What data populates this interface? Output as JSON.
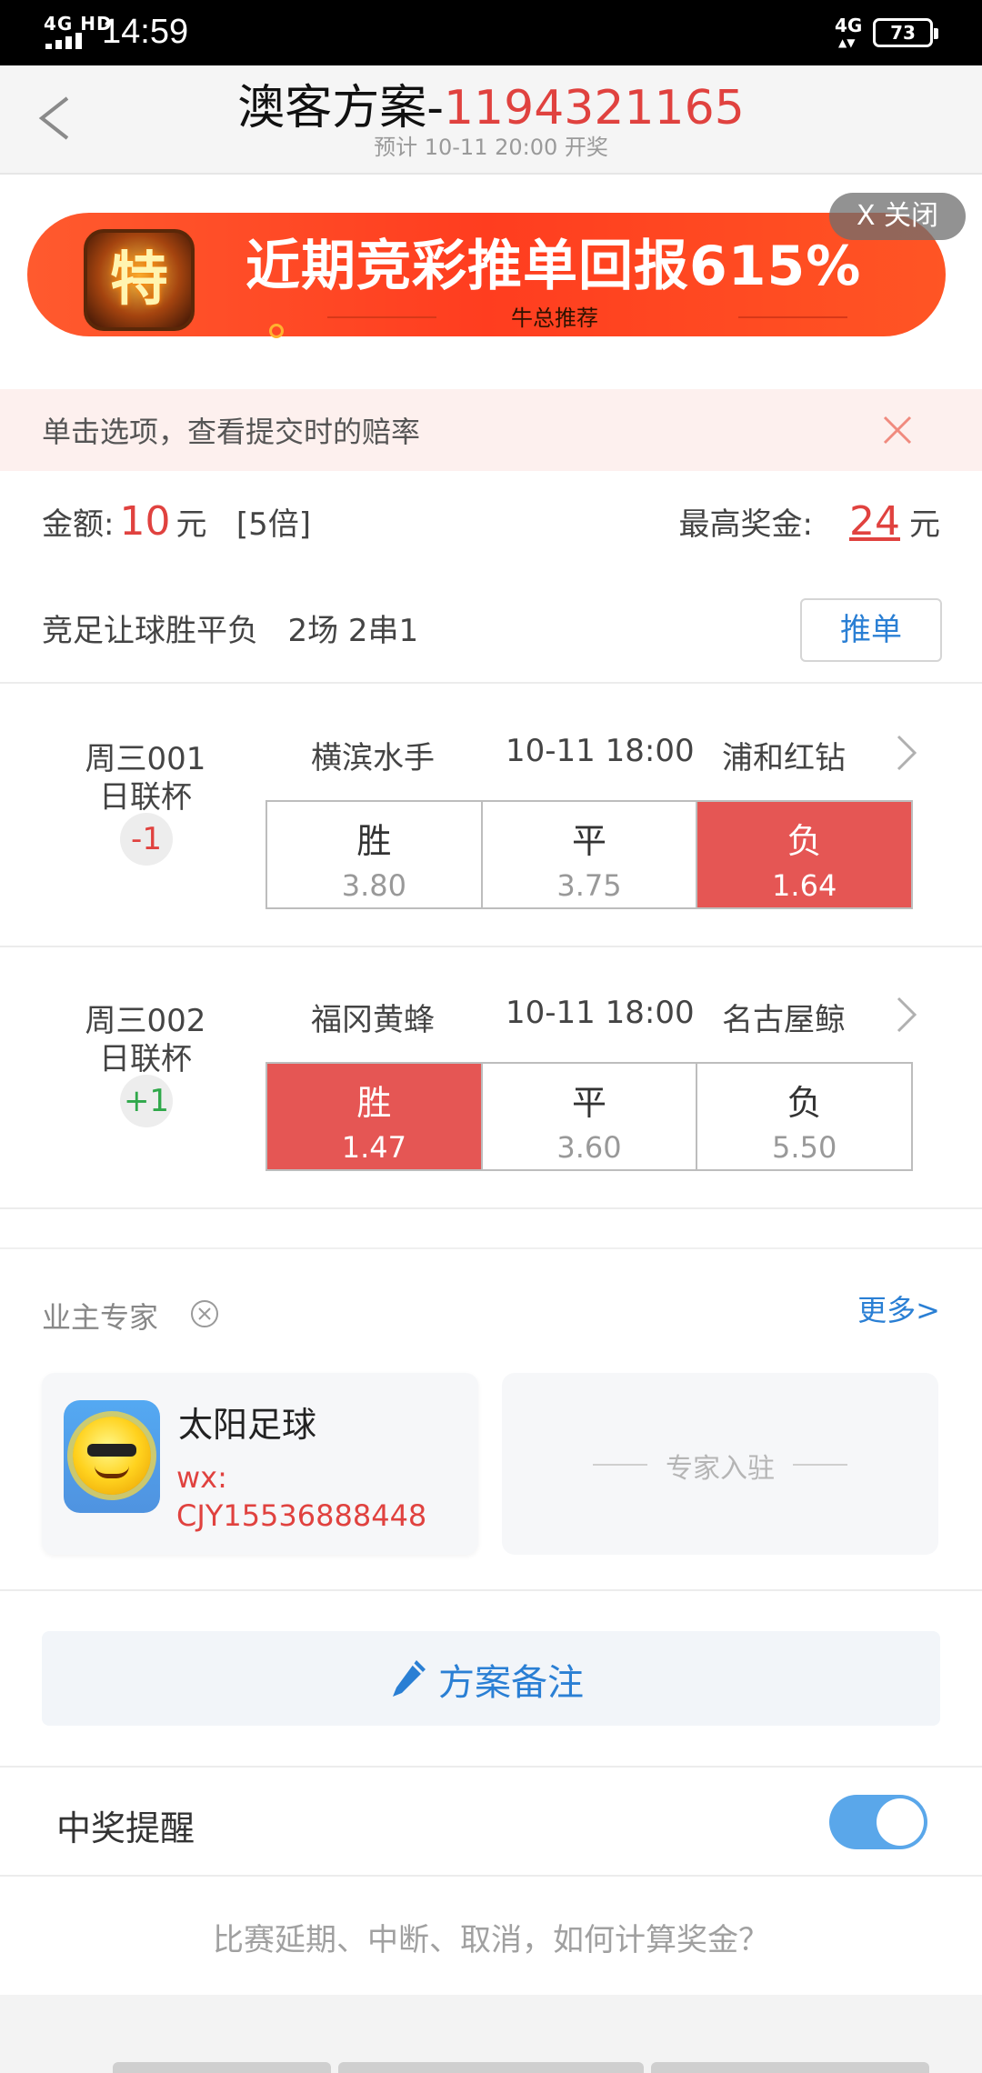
{
  "status_bar": {
    "network": "4G HD",
    "time": "14:59",
    "signal_right": "4G",
    "battery": "73"
  },
  "header": {
    "title_prefix": "澳客方案-",
    "scheme_id": "1194321165",
    "subtitle": "预计 10-11 20:00 开奖"
  },
  "banner": {
    "logo_text": "特",
    "headline": "近期竞彩推单回报615%",
    "sub": "牛总推荐",
    "close_label": "X 关闭"
  },
  "tip": {
    "text": "单击选项，查看提交时的赔率"
  },
  "amount": {
    "label": "金额:",
    "value": "10",
    "unit": "元",
    "multiple": "[5倍]",
    "max_label": "最高奖金:",
    "max_value": "24",
    "max_unit": "元"
  },
  "play": {
    "type": "竞足让球胜平负",
    "detail": "2场 2串1",
    "push_label": "推单"
  },
  "matches": [
    {
      "code": "周三001",
      "league": "日联杯",
      "handicap": "-1",
      "home": "横滨水手",
      "time": "10-11 18:00",
      "away": "浦和红钻",
      "options": [
        {
          "label": "胜",
          "odds": "3.80",
          "selected": false
        },
        {
          "label": "平",
          "odds": "3.75",
          "selected": false
        },
        {
          "label": "负",
          "odds": "1.64",
          "selected": true
        }
      ]
    },
    {
      "code": "周三002",
      "league": "日联杯",
      "handicap": "+1",
      "home": "福冈黄蜂",
      "time": "10-11 18:00",
      "away": "名古屋鲸",
      "options": [
        {
          "label": "胜",
          "odds": "1.47",
          "selected": true
        },
        {
          "label": "平",
          "odds": "3.60",
          "selected": false
        },
        {
          "label": "负",
          "odds": "5.50",
          "selected": false
        }
      ]
    }
  ],
  "expert": {
    "section_title": "业主专家",
    "more_label": "更多>",
    "name": "太阳足球",
    "wx_label": "wx:",
    "wx_id": "CJY15536888448",
    "join_label": "专家入驻"
  },
  "remark": {
    "label": "方案备注"
  },
  "reminder": {
    "label": "中奖提醒",
    "enabled": true
  },
  "faq": {
    "text": "比赛延期、中断、取消，如何计算奖金？"
  },
  "colors": {
    "accent_red": "#e0423f",
    "link_blue": "#2a7fd4",
    "selected_option": "#e55654",
    "toggle_on": "#5aa7ea"
  }
}
